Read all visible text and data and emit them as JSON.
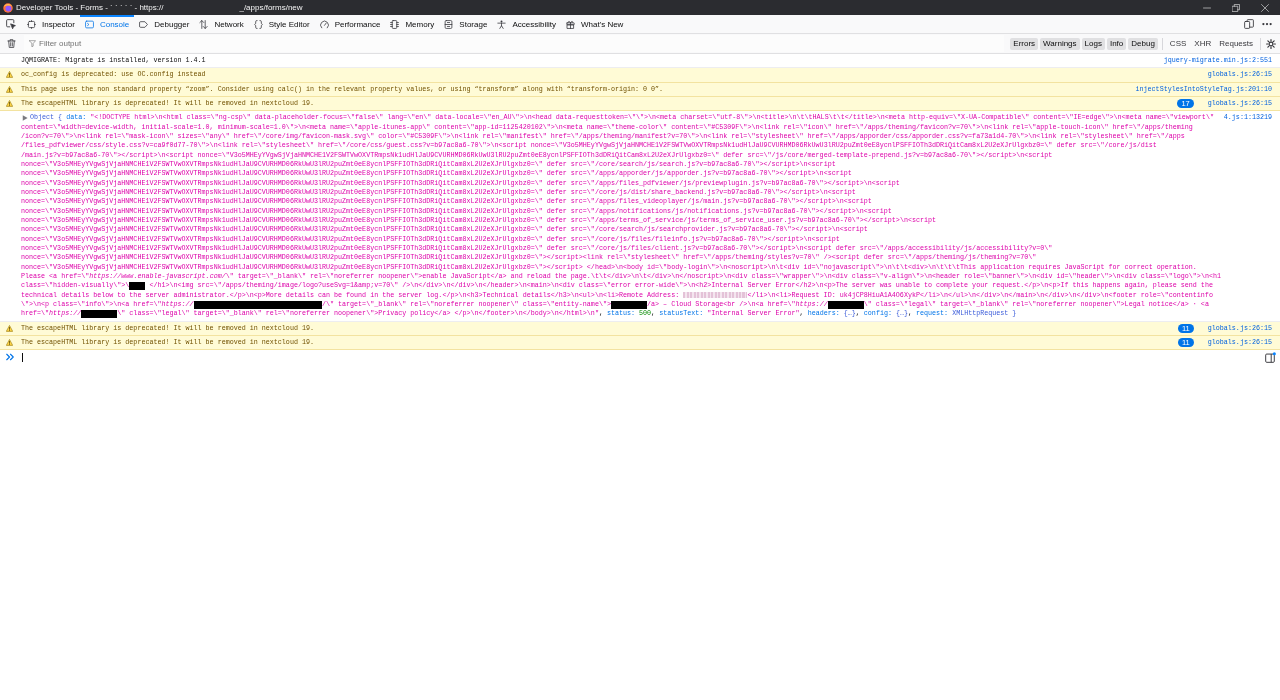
{
  "window": {
    "title": [
      "Developer Tools - Forms - ` ` ` ` ` - https://",
      "_/apps/forms/new"
    ]
  },
  "tabs": [
    {
      "label": "Inspector",
      "selected": false
    },
    {
      "label": "Console",
      "selected": true
    },
    {
      "label": "Debugger",
      "selected": false
    },
    {
      "label": "Network",
      "selected": false
    },
    {
      "label": "Style Editor",
      "selected": false
    },
    {
      "label": "Performance",
      "selected": false
    },
    {
      "label": "Memory",
      "selected": false
    },
    {
      "label": "Storage",
      "selected": false
    },
    {
      "label": "Accessibility",
      "selected": false
    },
    {
      "label": "What's New",
      "selected": false
    }
  ],
  "filter": {
    "placeholder": "Filter output"
  },
  "level_filters": [
    {
      "label": "Errors",
      "checked": true
    },
    {
      "label": "Warnings",
      "checked": true
    },
    {
      "label": "Logs",
      "checked": true
    },
    {
      "label": "Info",
      "checked": true
    },
    {
      "label": "Debug",
      "checked": true
    }
  ],
  "type_filters": [
    {
      "label": "CSS",
      "checked": false
    },
    {
      "label": "XHR",
      "checked": false
    },
    {
      "label": "Requests",
      "checked": false
    }
  ],
  "messages": [
    {
      "kind": "log",
      "text": "JQMIGRATE: Migrate is installed, version 1.4.1",
      "source": "jquery-migrate.min.js:2:551"
    },
    {
      "kind": "warning",
      "text": "oc_config is deprecated: use OC.config instead",
      "source": "globals.js:26:15"
    },
    {
      "kind": "warning",
      "text": "This page uses the non standard property “zoom”. Consider using calc() in the relevant property values, or using “transform” along with “transform-origin: 0 0”.",
      "source": "injectStylesIntoStyleTag.js:201:10"
    },
    {
      "kind": "warning",
      "text": "The escapeHTML library is deprecated! It will be removed in nextcloud 19.",
      "repeat_count": "17",
      "source": "globals.js:26:15"
    },
    {
      "kind": "object",
      "expanded": false,
      "source": "4.js:1:13219",
      "lines": [
        [
          {
            "kind": "object",
            "text": "Object { "
          },
          {
            "kind": "key",
            "text": "data: "
          },
          {
            "kind": "string",
            "text": "\"<!DOCTYPE html>\\n<html class=\\\"ng-csp\\\" data-placeholder-focus=\\\"false\\\" lang=\\\"en\\\" data-locale=\\\"en_AU\\\">\\n<head data-requesttoken=\\\"\\\">\\n<meta charset=\\\"utf-8\\\">\\n<title>\\n\\t\\tHALS\\t\\t</title>\\n<meta http-equiv=\\\"X-UA-Compatible\\\" content=\\\"IE=edge\\\">\\n<meta name=\\\"viewport\\\""
          }
        ],
        [
          {
            "kind": "string",
            "text": "content=\\\"width=device-width, initial-scale=1.0, minimum-scale=1.0\\\">\\n<meta name=\\\"apple-itunes-app\\\" content=\\\"app-id=1125420102\\\">\\n<meta name=\\\"theme-color\\\" content=\\\"#C5309F\\\">\\n<link rel=\\\"icon\\\" href=\\\"/apps/theming/favicon?v=70\\\">\\n<link rel=\\\"apple-touch-icon\\\" href=\\\"/apps/theming"
          }
        ],
        [
          {
            "kind": "string",
            "text": "/icon?v=70\\\">\\n<link rel=\\\"mask-icon\\\" sizes=\\\"any\\\" href=\\\"/core/img/favicon-mask.svg\\\" color=\\\"#C5309F\\\">\\n<link rel=\\\"manifest\\\" href=\\\"/apps/theming/manifest?v=70\\\">\\n<link rel=\\\"stylesheet\\\" href=\\\"/apps/apporder/css/apporder.css?v=fa73a1d4-70\\\">\\n<link rel=\\\"stylesheet\\\" href=\\\"/apps"
          }
        ],
        [
          {
            "kind": "string",
            "text": "/files_pdfviewer/css/style.css?v=ca9f0d77-70\\\">\\n<link rel=\\\"stylesheet\\\" href=\\\"/core/css/guest.css?v=b97ac8a6-70\\\">\\n<script nonce=\\\"V3o5MHEyYVgwSjVjaHNMCHE1V2FSWTVwOXVTRmpsNk1udHlJaU9CVURHMD06RkUwU3lRU2puZmt0eE8ycnlPSFFIOTh3dDRiQitCam8xL2U2eXJrUlgxbz0=\\\" defer src=\\\"/core/js/dist"
          }
        ],
        [
          {
            "kind": "string",
            "text": "/main.js?v=b97ac8a6-70\\\"></script>\\n<script nonce=\\\"V3o5MHEyYVgwSjVjaHNMCHE1V2FSWTVwOXVTRmpsNk1udHlJaU9CVURHMD06RkUwU3lRU2puZmt0eE8ycnlPSFFIOTh3dDRiQitCam8xL2U2eXJrUlgxbz0=\\\" defer src=\\\"/js/core/merged-template-prepend.js?v=b97ac8a6-70\\\"></script>\\n<script"
          }
        ],
        [
          {
            "kind": "string",
            "text": "nonce=\\\"V3o5MHEyYVgwSjVjaHNMCHE1V2FSWTVwOXVTRmpsNk1udHlJaU9CVURHMD06RkUwU3lRU2puZmt0eE8ycnlPSFFIOTh3dDRiQitCam8xL2U2eXJrUlgxbz0=\\\" defer src=\\\"/core/search/js/search.js?v=b97ac8a6-70\\\"></script>\\n<script"
          }
        ],
        [
          {
            "kind": "string",
            "text": "nonce=\\\"V3o5MHEyYVgwSjVjaHNMCHE1V2FSWTVwOXVTRmpsNk1udHlJaU9CVURHMD06RkUwU3lRU2puZmt0eE8ycnlPSFFIOTh3dDRiQitCam8xL2U2eXJrUlgxbz0=\\\" defer src=\\\"/apps/apporder/js/apporder.js?v=b97ac8a6-70\\\"></script>\\n<script"
          }
        ],
        [
          {
            "kind": "string",
            "text": "nonce=\\\"V3o5MHEyYVgwSjVjaHNMCHE1V2FSWTVwOXVTRmpsNk1udHlJaU9CVURHMD06RkUwU3lRU2puZmt0eE8ycnlPSFFIOTh3dDRiQitCam8xL2U2eXJrUlgxbz0=\\\" defer src=\\\"/apps/files_pdfviewer/js/previewplugin.js?v=b97ac8a6-70\\\"></script>\\n<script"
          }
        ],
        [
          {
            "kind": "string",
            "text": "nonce=\\\"V3o5MHEyYVgwSjVjaHNMCHE1V2FSWTVwOXVTRmpsNk1udHlJaU9CVURHMD06RkUwU3lRU2puZmt0eE8ycnlPSFFIOTh3dDRiQitCam8xL2U2eXJrUlgxbz0=\\\" defer src=\\\"/core/js/dist/share_backend.js?v=b97ac8a6-70\\\"></script>\\n<script"
          }
        ],
        [
          {
            "kind": "string",
            "text": "nonce=\\\"V3o5MHEyYVgwSjVjaHNMCHE1V2FSWTVwOXVTRmpsNk1udHlJaU9CVURHMD06RkUwU3lRU2puZmt0eE8ycnlPSFFIOTh3dDRiQitCam8xL2U2eXJrUlgxbz0=\\\" defer src=\\\"/apps/files_videoplayer/js/main.js?v=b97ac8a6-70\\\"></script>\\n<script"
          }
        ],
        [
          {
            "kind": "string",
            "text": "nonce=\\\"V3o5MHEyYVgwSjVjaHNMCHE1V2FSWTVwOXVTRmpsNk1udHlJaU9CVURHMD06RkUwU3lRU2puZmt0eE8ycnlPSFFIOTh3dDRiQitCam8xL2U2eXJrUlgxbz0=\\\" defer src=\\\"/apps/notifications/js/notifications.js?v=b97ac8a6-70\\\"></script>\\n<script"
          }
        ],
        [
          {
            "kind": "string",
            "text": "nonce=\\\"V3o5MHEyYVgwSjVjaHNMCHE1V2FSWTVwOXVTRmpsNk1udHlJaU9CVURHMD06RkUwU3lRU2puZmt0eE8ycnlPSFFIOTh3dDRiQitCam8xL2U2eXJrUlgxbz0=\\\" defer src=\\\"/apps/terms_of_service/js/terms_of_service_user.js?v=b97ac8a6-70\\\"></script>\\n<script"
          }
        ],
        [
          {
            "kind": "string",
            "text": "nonce=\\\"V3o5MHEyYVgwSjVjaHNMCHE1V2FSWTVwOXVTRmpsNk1udHlJaU9CVURHMD06RkUwU3lRU2puZmt0eE8ycnlPSFFIOTh3dDRiQitCam8xL2U2eXJrUlgxbz0=\\\" defer src=\\\"/core/search/js/searchprovider.js?v=b97ac8a6-70\\\"></script>\\n<script"
          }
        ],
        [
          {
            "kind": "string",
            "text": "nonce=\\\"V3o5MHEyYVgwSjVjaHNMCHE1V2FSWTVwOXVTRmpsNk1udHlJaU9CVURHMD06RkUwU3lRU2puZmt0eE8ycnlPSFFIOTh3dDRiQitCam8xL2U2eXJrUlgxbz0=\\\" defer src=\\\"/core/js/files/fileinfo.js?v=b97ac8a6-70\\\"></script>\\n<script"
          }
        ],
        [
          {
            "kind": "string",
            "text": "nonce=\\\"V3o5MHEyYVgwSjVjaHNMCHE1V2FSWTVwOXVTRmpsNk1udHlJaU9CVURHMD06RkUwU3lRU2puZmt0eE8ycnlPSFFIOTh3dDRiQitCam8xL2U2eXJrUlgxbz0=\\\" defer src=\\\"/core/js/files/client.js?v=b97ac8a6-70\\\"></script>\\n<script defer src=\\\"/apps/accessibility/js/accessibility?v=0\\\""
          }
        ],
        [
          {
            "kind": "string",
            "text": "nonce=\\\"V3o5MHEyYVgwSjVjaHNMCHE1V2FSWTVwOXVTRmpsNk1udHlJaU9CVURHMD06RkUwU3lRU2puZmt0eE8ycnlPSFFIOTh3dDRiQitCam8xL2U2eXJrUlgxbz0=\\\"></script><link rel=\\\"stylesheet\\\" href=\\\"/apps/theming/styles?v=70\\\" /><script defer src=\\\"/apps/theming/js/theming?v=70\\\""
          }
        ],
        [
          {
            "kind": "string",
            "text": "nonce=\\\"V3o5MHEyYVgwSjVjaHNMCHE1V2FSWTVwOXVTRmpsNk1udHlJaU9CVURHMD06RkUwU3lRU2puZmt0eE8ycnlPSFFIOTh3dDRiQitCam8xL2U2eXJrUlgxbz0=\\\"></script> </head>\\n<body id=\\\"body-login\\\">\\n<noscript>\\n\\t<div id=\\\"nojavascript\\\">\\n\\t\\t<div>\\n\\t\\t\\tThis application requires JavaScript for correct operation."
          }
        ],
        [
          {
            "kind": "string",
            "text": "Please <a href=\\\""
          },
          {
            "kind": "url",
            "text": "https://www.enable-javascript.com/"
          },
          {
            "kind": "string",
            "text": "\\\" target=\\\"_blank\\\" rel=\\\"noreferrer noopener\\\">enable JavaScript</a> and reload the page.\\t\\t</div>\\n\\t</div>\\n</noscript>\\n<div class=\\\"wrapper\\\">\\n<div class=\\\"v-align\\\">\\n<header role=\\\"banner\\\">\\n<div id=\\\"header\\\">\\n<div class=\\\"logo\\\">\\n<h1"
          }
        ],
        [
          {
            "kind": "string",
            "text": "class=\\\"hidden-visually\\\">\\"
          },
          {
            "kind": "redacted"
          },
          {
            "kind": "string",
            "text": " </h1>\\n<img src=\\\"/apps/theming/image/logo?useSvg=1&amp;v=70\\\" />\\n</div>\\n</div>\\n</header>\\n<main>\\n<div class=\\\"error error-wide\\\">\\n<h2>Internal Server Error</h2>\\n<p>The server was unable to complete your request.</p>\\n<p>If this happens again, please send the"
          }
        ],
        [
          {
            "kind": "string",
            "text": "technical details below to the server administrator.</p>\\n<p>More details can be found in the server log.</p>\\n<h3>Technical details</h3>\\n<ul>\\n<li>Remote Address: "
          },
          {
            "kind": "blurred"
          },
          {
            "kind": "string",
            "text": "</li>\\n<li>Request ID: uk4jCP8HiuA1A4O6XykP</li>\\n</ul>\\n</div>\\n</main>\\n</div>\\n</div>\\n<footer role=\\\"contentinfo"
          }
        ],
        [
          {
            "kind": "string",
            "text": "\\\">\\n<p class=\\\"info\\\">\\n<a href=\\\""
          },
          {
            "kind": "url",
            "text": "https://"
          },
          {
            "kind": "redacted"
          },
          {
            "kind": "string",
            "text": "/\\\" target=\\\"_blank\\\" rel=\\\"noreferrer noopener\\\" class=\\\"entity-name\\\">"
          },
          {
            "kind": "redacted"
          },
          {
            "kind": "string",
            "text": "/a> – Cloud Storage<br />\\n<a href=\\\""
          },
          {
            "kind": "url",
            "text": "https://"
          },
          {
            "kind": "redacted"
          },
          {
            "kind": "string",
            "text": "\\\" class=\\\"legal\\\" target=\\\"_blank\\\" rel=\\\"noreferrer noopener\\\">Legal notice</a> · <a"
          }
        ],
        [
          {
            "kind": "string",
            "text": "href=\\\""
          },
          {
            "kind": "url",
            "text": "https://"
          },
          {
            "kind": "redacted"
          },
          {
            "kind": "string",
            "text": "\\\" class=\\\"legal\\\" target=\\\"_blank\\\" rel=\\\"noreferrer noopener\\\">Privacy policy</a> </p>\\n</footer>\\n</body>\\n</html>\\n\""
          },
          {
            "kind": "punct",
            "text": ", "
          },
          {
            "kind": "key",
            "text": "status: "
          },
          {
            "kind": "number",
            "text": "500"
          },
          {
            "kind": "punct",
            "text": ", "
          },
          {
            "kind": "key",
            "text": "statusText: "
          },
          {
            "kind": "string",
            "text": "\"Internal Server Error\""
          },
          {
            "kind": "punct",
            "text": ", "
          },
          {
            "kind": "key",
            "text": "headers: "
          },
          {
            "kind": "object",
            "text": "{…}"
          },
          {
            "kind": "punct",
            "text": ", "
          },
          {
            "kind": "key",
            "text": "config: "
          },
          {
            "kind": "object",
            "text": "{…}"
          },
          {
            "kind": "punct",
            "text": ", "
          },
          {
            "kind": "key",
            "text": "request: "
          },
          {
            "kind": "object",
            "text": "XMLHttpRequest }"
          }
        ]
      ]
    },
    {
      "kind": "warning",
      "text": "The escapeHTML library is deprecated! It will be removed in nextcloud 19.",
      "repeat_count": "11",
      "source": "globals.js:26:15"
    },
    {
      "kind": "warning",
      "text": "The escapeHTML library is deprecated! It will be removed in nextcloud 19.",
      "repeat_count": "11",
      "source": "globals.js:26:15"
    }
  ]
}
